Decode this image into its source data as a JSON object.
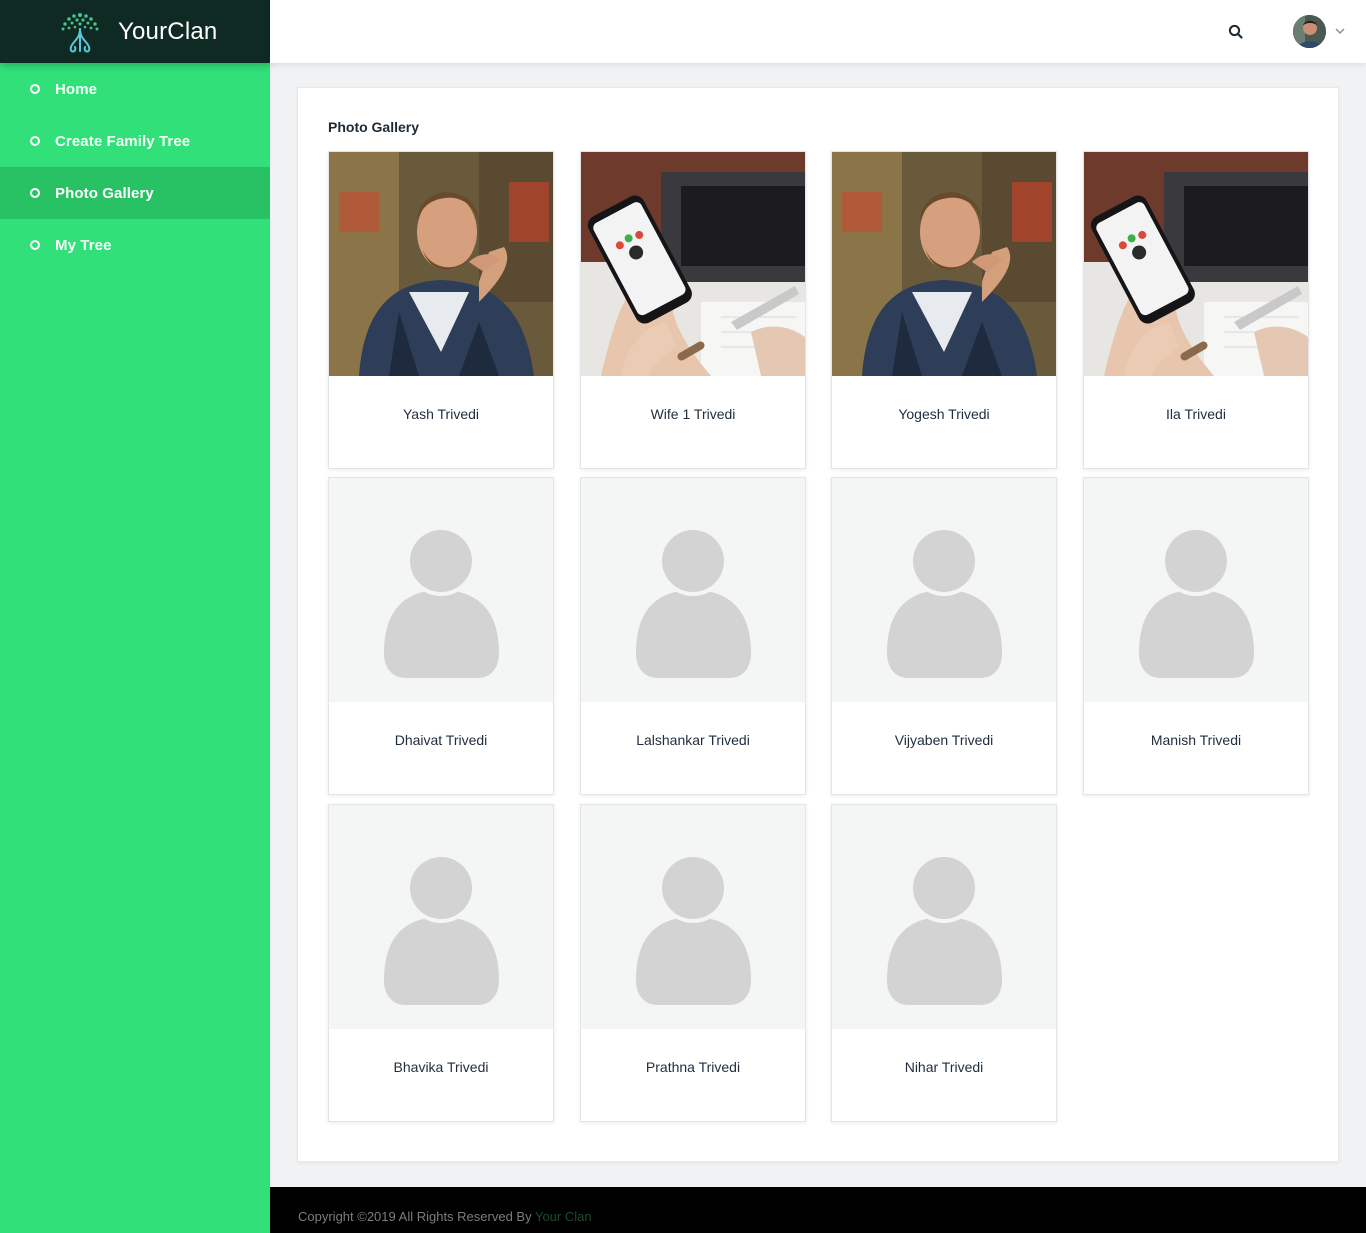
{
  "brand": {
    "name": "YourClan",
    "logo_icon": "tree-logo-icon"
  },
  "sidebar": {
    "items": [
      {
        "label": "Home",
        "active": false
      },
      {
        "label": "Create Family Tree",
        "active": false
      },
      {
        "label": "Photo Gallery",
        "active": true
      },
      {
        "label": "My Tree",
        "active": false
      }
    ]
  },
  "topbar": {
    "search_icon": "search-icon",
    "avatar_icon": "user-avatar",
    "dropdown_icon": "chevron-down-icon"
  },
  "gallery": {
    "title": "Photo Gallery",
    "members": [
      {
        "name": "Yash Trivedi",
        "photo": "man-portrait"
      },
      {
        "name": "Wife 1 Trivedi",
        "photo": "phone-in-hand"
      },
      {
        "name": "Yogesh Trivedi",
        "photo": "man-portrait"
      },
      {
        "name": "Ila Trivedi",
        "photo": "phone-in-hand"
      },
      {
        "name": "Dhaivat Trivedi",
        "photo": "placeholder"
      },
      {
        "name": "Lalshankar Trivedi",
        "photo": "placeholder"
      },
      {
        "name": "Vijyaben Trivedi",
        "photo": "placeholder"
      },
      {
        "name": "Manish Trivedi",
        "photo": "placeholder"
      },
      {
        "name": "Bhavika Trivedi",
        "photo": "placeholder"
      },
      {
        "name": "Prathna Trivedi",
        "photo": "placeholder"
      },
      {
        "name": "Nihar Trivedi",
        "photo": "placeholder"
      }
    ]
  },
  "footer": {
    "text": "Copyright ©2019 All Rights Reserved By ",
    "link": "Your Clan"
  },
  "colors": {
    "sidebar": "#32e079",
    "sidebar_active": "#28c265",
    "brand_bg": "#0f2a22",
    "footer_bg": "#000000",
    "placeholder": "#d3d3d3"
  }
}
